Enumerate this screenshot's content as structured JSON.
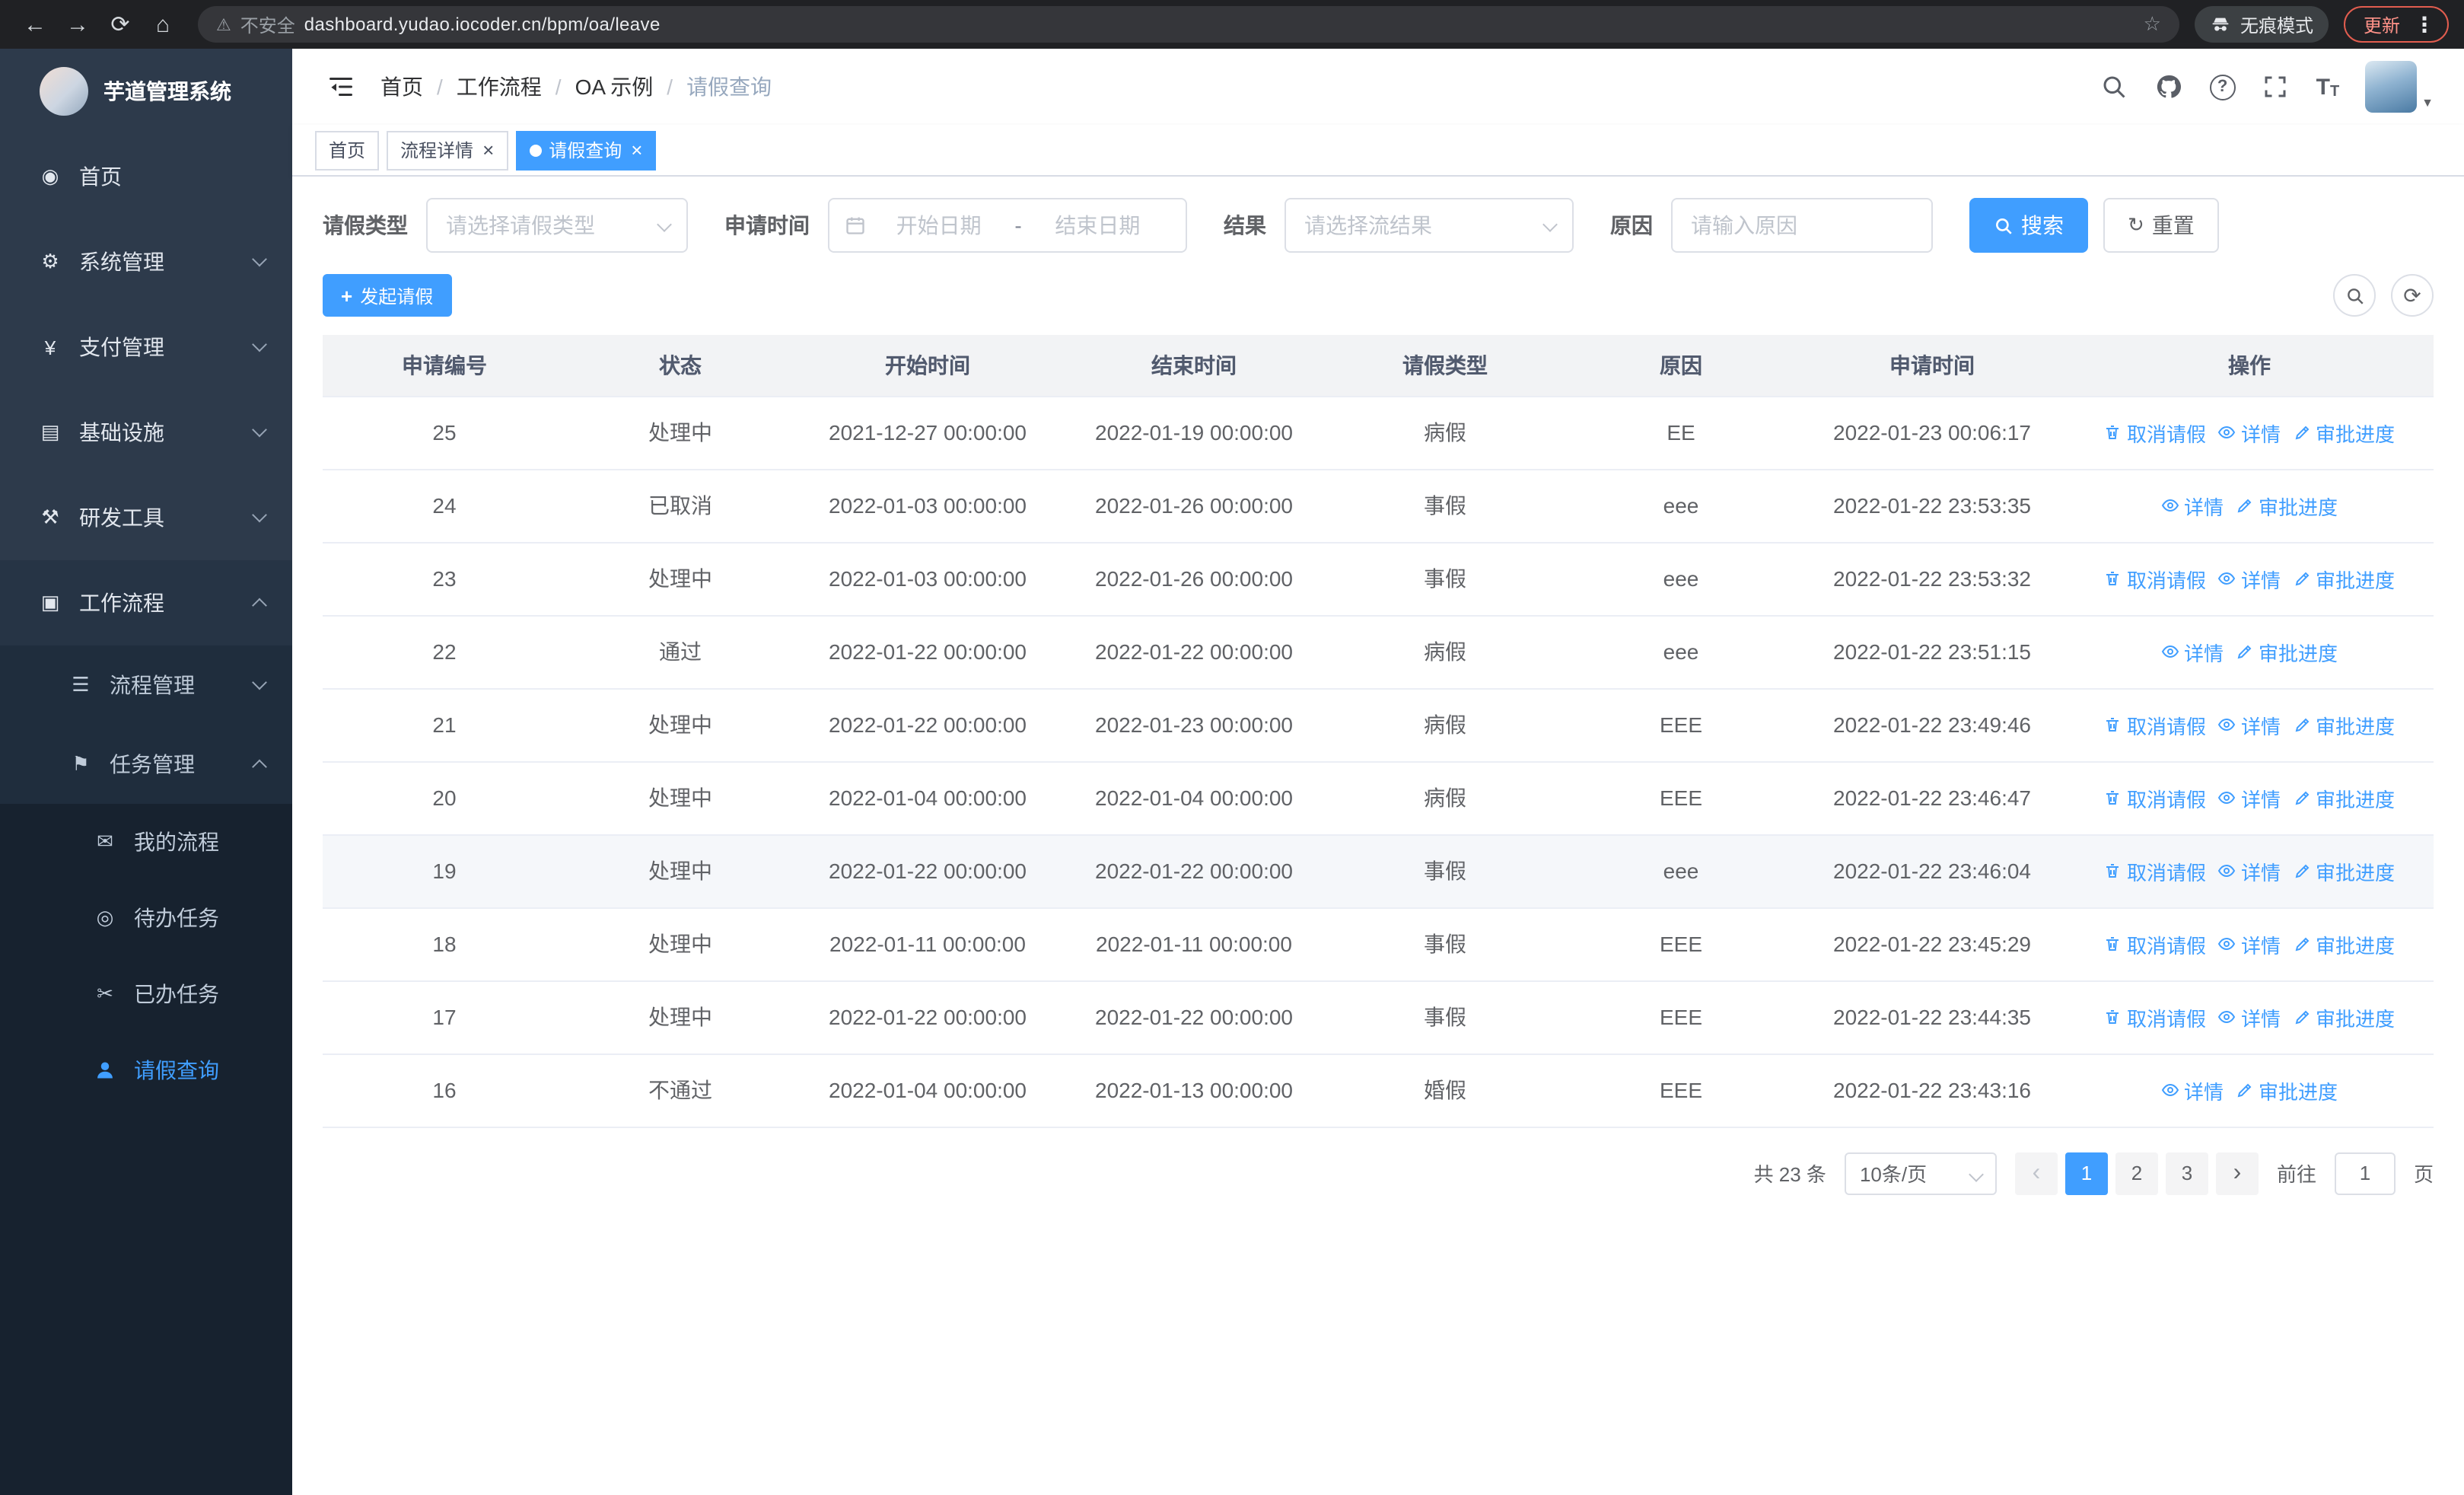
{
  "browser": {
    "security_label": "不安全",
    "url": "dashboard.yudao.iocoder.cn/bpm/oa/leave",
    "incognito_label": "无痕模式",
    "update_label": "更新"
  },
  "sidebar": {
    "title": "芋道管理系统",
    "menu": [
      {
        "label": "首页",
        "name": "home",
        "icon": "dashboard-icon",
        "level": 1
      },
      {
        "label": "系统管理",
        "name": "system-management",
        "icon": "gear-icon",
        "level": 1,
        "arrow": "down"
      },
      {
        "label": "支付管理",
        "name": "payment-management",
        "icon": "yen-icon",
        "level": 1,
        "arrow": "down"
      },
      {
        "label": "基础设施",
        "name": "infrastructure",
        "icon": "infrastructure-icon",
        "level": 1,
        "arrow": "down"
      },
      {
        "label": "研发工具",
        "name": "dev-tools",
        "icon": "devtools-icon",
        "level": 1,
        "arrow": "down"
      },
      {
        "label": "工作流程",
        "name": "workflow",
        "icon": "workflow-icon",
        "level": 1,
        "arrow": "up",
        "open": true
      },
      {
        "label": "流程管理",
        "name": "process-management",
        "icon": "process-icon",
        "level": 2,
        "arrow": "down"
      },
      {
        "label": "任务管理",
        "name": "task-management",
        "icon": "task-icon",
        "level": 2,
        "arrow": "up",
        "open": true
      },
      {
        "label": "我的流程",
        "name": "my-processes",
        "icon": "chat-icon",
        "level": 3
      },
      {
        "label": "待办任务",
        "name": "todo-tasks",
        "icon": "eye-icon",
        "level": 3
      },
      {
        "label": "已办任务",
        "name": "done-tasks",
        "icon": "scissors-icon",
        "level": 3
      },
      {
        "label": "请假查询",
        "name": "leave-query",
        "icon": "user-icon",
        "level": 3,
        "active": true
      }
    ]
  },
  "icons": {
    "dashboard-icon": "◉",
    "gear-icon": "⚙",
    "yen-icon": "¥",
    "infrastructure-icon": "▤",
    "devtools-icon": "⚒",
    "workflow-icon": "▣",
    "process-icon": "☰",
    "task-icon": "⚑",
    "chat-icon": "✉",
    "eye-icon": "◎",
    "scissors-icon": "✂",
    "user-icon": "svg:user"
  },
  "header": {
    "separator": "/",
    "breadcrumb": [
      {
        "label": "首页",
        "name": "home"
      },
      {
        "label": "工作流程",
        "name": "workflow"
      },
      {
        "label": "OA 示例",
        "name": "oa-example"
      },
      {
        "label": "请假查询",
        "name": "leave-query",
        "current": true
      }
    ]
  },
  "tags": [
    {
      "label": "首页",
      "name": "home"
    },
    {
      "label": "流程详情",
      "name": "process-detail",
      "closable": true
    },
    {
      "label": "请假查询",
      "name": "leave-query",
      "active": true,
      "closable": true
    }
  ],
  "filters": {
    "leave_type_label": "请假类型",
    "leave_type_placeholder": "请选择请假类型",
    "apply_time_label": "申请时间",
    "start_date_placeholder": "开始日期",
    "range_separator": "-",
    "end_date_placeholder": "结束日期",
    "result_label": "结果",
    "result_placeholder": "请选择流结果",
    "reason_label": "原因",
    "reason_placeholder": "请输入原因",
    "search_button": "搜索",
    "reset_button": "重置"
  },
  "toolbar": {
    "create_label": "发起请假"
  },
  "table": {
    "columns": [
      "申请编号",
      "状态",
      "开始时间",
      "结束时间",
      "请假类型",
      "原因",
      "申请时间",
      "操作"
    ],
    "action_labels": {
      "cancel": "取消请假",
      "detail": "详情",
      "progress": "审批进度"
    },
    "rows": [
      {
        "id": "25",
        "status": "处理中",
        "start": "2021-12-27 00:00:00",
        "end": "2022-01-19 00:00:00",
        "type": "病假",
        "reason": "EE",
        "applied": "2022-01-23 00:06:17",
        "actions": [
          "cancel",
          "detail",
          "progress"
        ]
      },
      {
        "id": "24",
        "status": "已取消",
        "start": "2022-01-03 00:00:00",
        "end": "2022-01-26 00:00:00",
        "type": "事假",
        "reason": "eee",
        "applied": "2022-01-22 23:53:35",
        "actions": [
          "detail",
          "progress"
        ]
      },
      {
        "id": "23",
        "status": "处理中",
        "start": "2022-01-03 00:00:00",
        "end": "2022-01-26 00:00:00",
        "type": "事假",
        "reason": "eee",
        "applied": "2022-01-22 23:53:32",
        "actions": [
          "cancel",
          "detail",
          "progress"
        ]
      },
      {
        "id": "22",
        "status": "通过",
        "start": "2022-01-22 00:00:00",
        "end": "2022-01-22 00:00:00",
        "type": "病假",
        "reason": "eee",
        "applied": "2022-01-22 23:51:15",
        "actions": [
          "detail",
          "progress"
        ]
      },
      {
        "id": "21",
        "status": "处理中",
        "start": "2022-01-22 00:00:00",
        "end": "2022-01-23 00:00:00",
        "type": "病假",
        "reason": "EEE",
        "applied": "2022-01-22 23:49:46",
        "actions": [
          "cancel",
          "detail",
          "progress"
        ]
      },
      {
        "id": "20",
        "status": "处理中",
        "start": "2022-01-04 00:00:00",
        "end": "2022-01-04 00:00:00",
        "type": "病假",
        "reason": "EEE",
        "applied": "2022-01-22 23:46:47",
        "actions": [
          "cancel",
          "detail",
          "progress"
        ]
      },
      {
        "id": "19",
        "status": "处理中",
        "start": "2022-01-22 00:00:00",
        "end": "2022-01-22 00:00:00",
        "type": "事假",
        "reason": "eee",
        "applied": "2022-01-22 23:46:04",
        "actions": [
          "cancel",
          "detail",
          "progress"
        ],
        "highlighted": true
      },
      {
        "id": "18",
        "status": "处理中",
        "start": "2022-01-11 00:00:00",
        "end": "2022-01-11 00:00:00",
        "type": "事假",
        "reason": "EEE",
        "applied": "2022-01-22 23:45:29",
        "actions": [
          "cancel",
          "detail",
          "progress"
        ]
      },
      {
        "id": "17",
        "status": "处理中",
        "start": "2022-01-22 00:00:00",
        "end": "2022-01-22 00:00:00",
        "type": "事假",
        "reason": "EEE",
        "applied": "2022-01-22 23:44:35",
        "actions": [
          "cancel",
          "detail",
          "progress"
        ]
      },
      {
        "id": "16",
        "status": "不通过",
        "start": "2022-01-04 00:00:00",
        "end": "2022-01-13 00:00:00",
        "type": "婚假",
        "reason": "EEE",
        "applied": "2022-01-22 23:43:16",
        "actions": [
          "detail",
          "progress"
        ]
      }
    ]
  },
  "pagination": {
    "total_text": "共 23 条",
    "page_size": "10条/页",
    "pages": [
      "1",
      "2",
      "3"
    ],
    "active_page": "1",
    "goto_label": "前往",
    "goto_value": "1",
    "page_unit": "页"
  },
  "colors": {
    "primary": "#409eff",
    "sidebar_bg": "#2d3a4b",
    "submenu_bg": "#1f2d3d",
    "active_tag_bg": "#409eff",
    "update_pill": "#e25d4f"
  }
}
